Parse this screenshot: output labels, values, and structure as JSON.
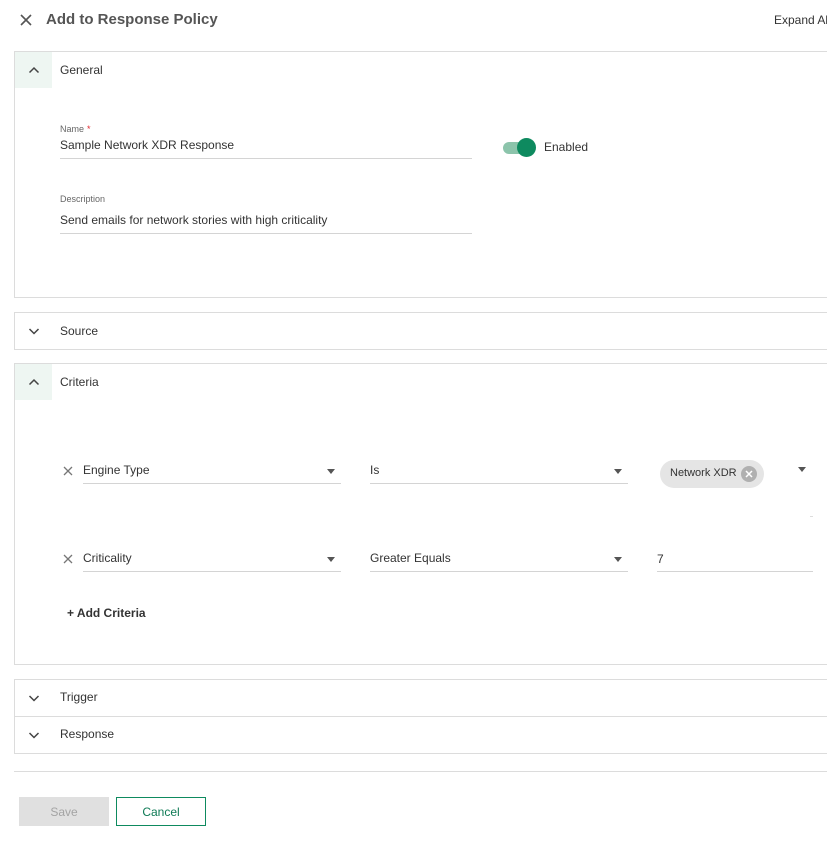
{
  "header": {
    "title": "Add to Response Policy",
    "expand_all_label": "Expand All"
  },
  "panels": {
    "general": {
      "title": "General",
      "expanded": true
    },
    "source": {
      "title": "Source",
      "expanded": false
    },
    "criteria": {
      "title": "Criteria",
      "expanded": true
    },
    "trigger": {
      "title": "Trigger",
      "expanded": false
    },
    "response": {
      "title": "Response",
      "expanded": false
    }
  },
  "general": {
    "name_label": "Name",
    "required_marker": "*",
    "name_value": "Sample Network XDR Response",
    "enabled_label": "Enabled",
    "enabled": true,
    "description_label": "Description",
    "description_value": "Send emails for network stories with high criticality"
  },
  "criteria": {
    "rows": [
      {
        "field": "Engine Type",
        "operator": "Is",
        "value_chip": "Network XDR"
      },
      {
        "field": "Criticality",
        "operator": "Greater Equals",
        "value": "7"
      }
    ],
    "add_label": "+ Add Criteria"
  },
  "footer": {
    "save_label": "Save",
    "cancel_label": "Cancel"
  },
  "colors": {
    "accent": "#0e8a5f",
    "toggle_track": "#8cc4ab",
    "required": "#e0282e"
  }
}
